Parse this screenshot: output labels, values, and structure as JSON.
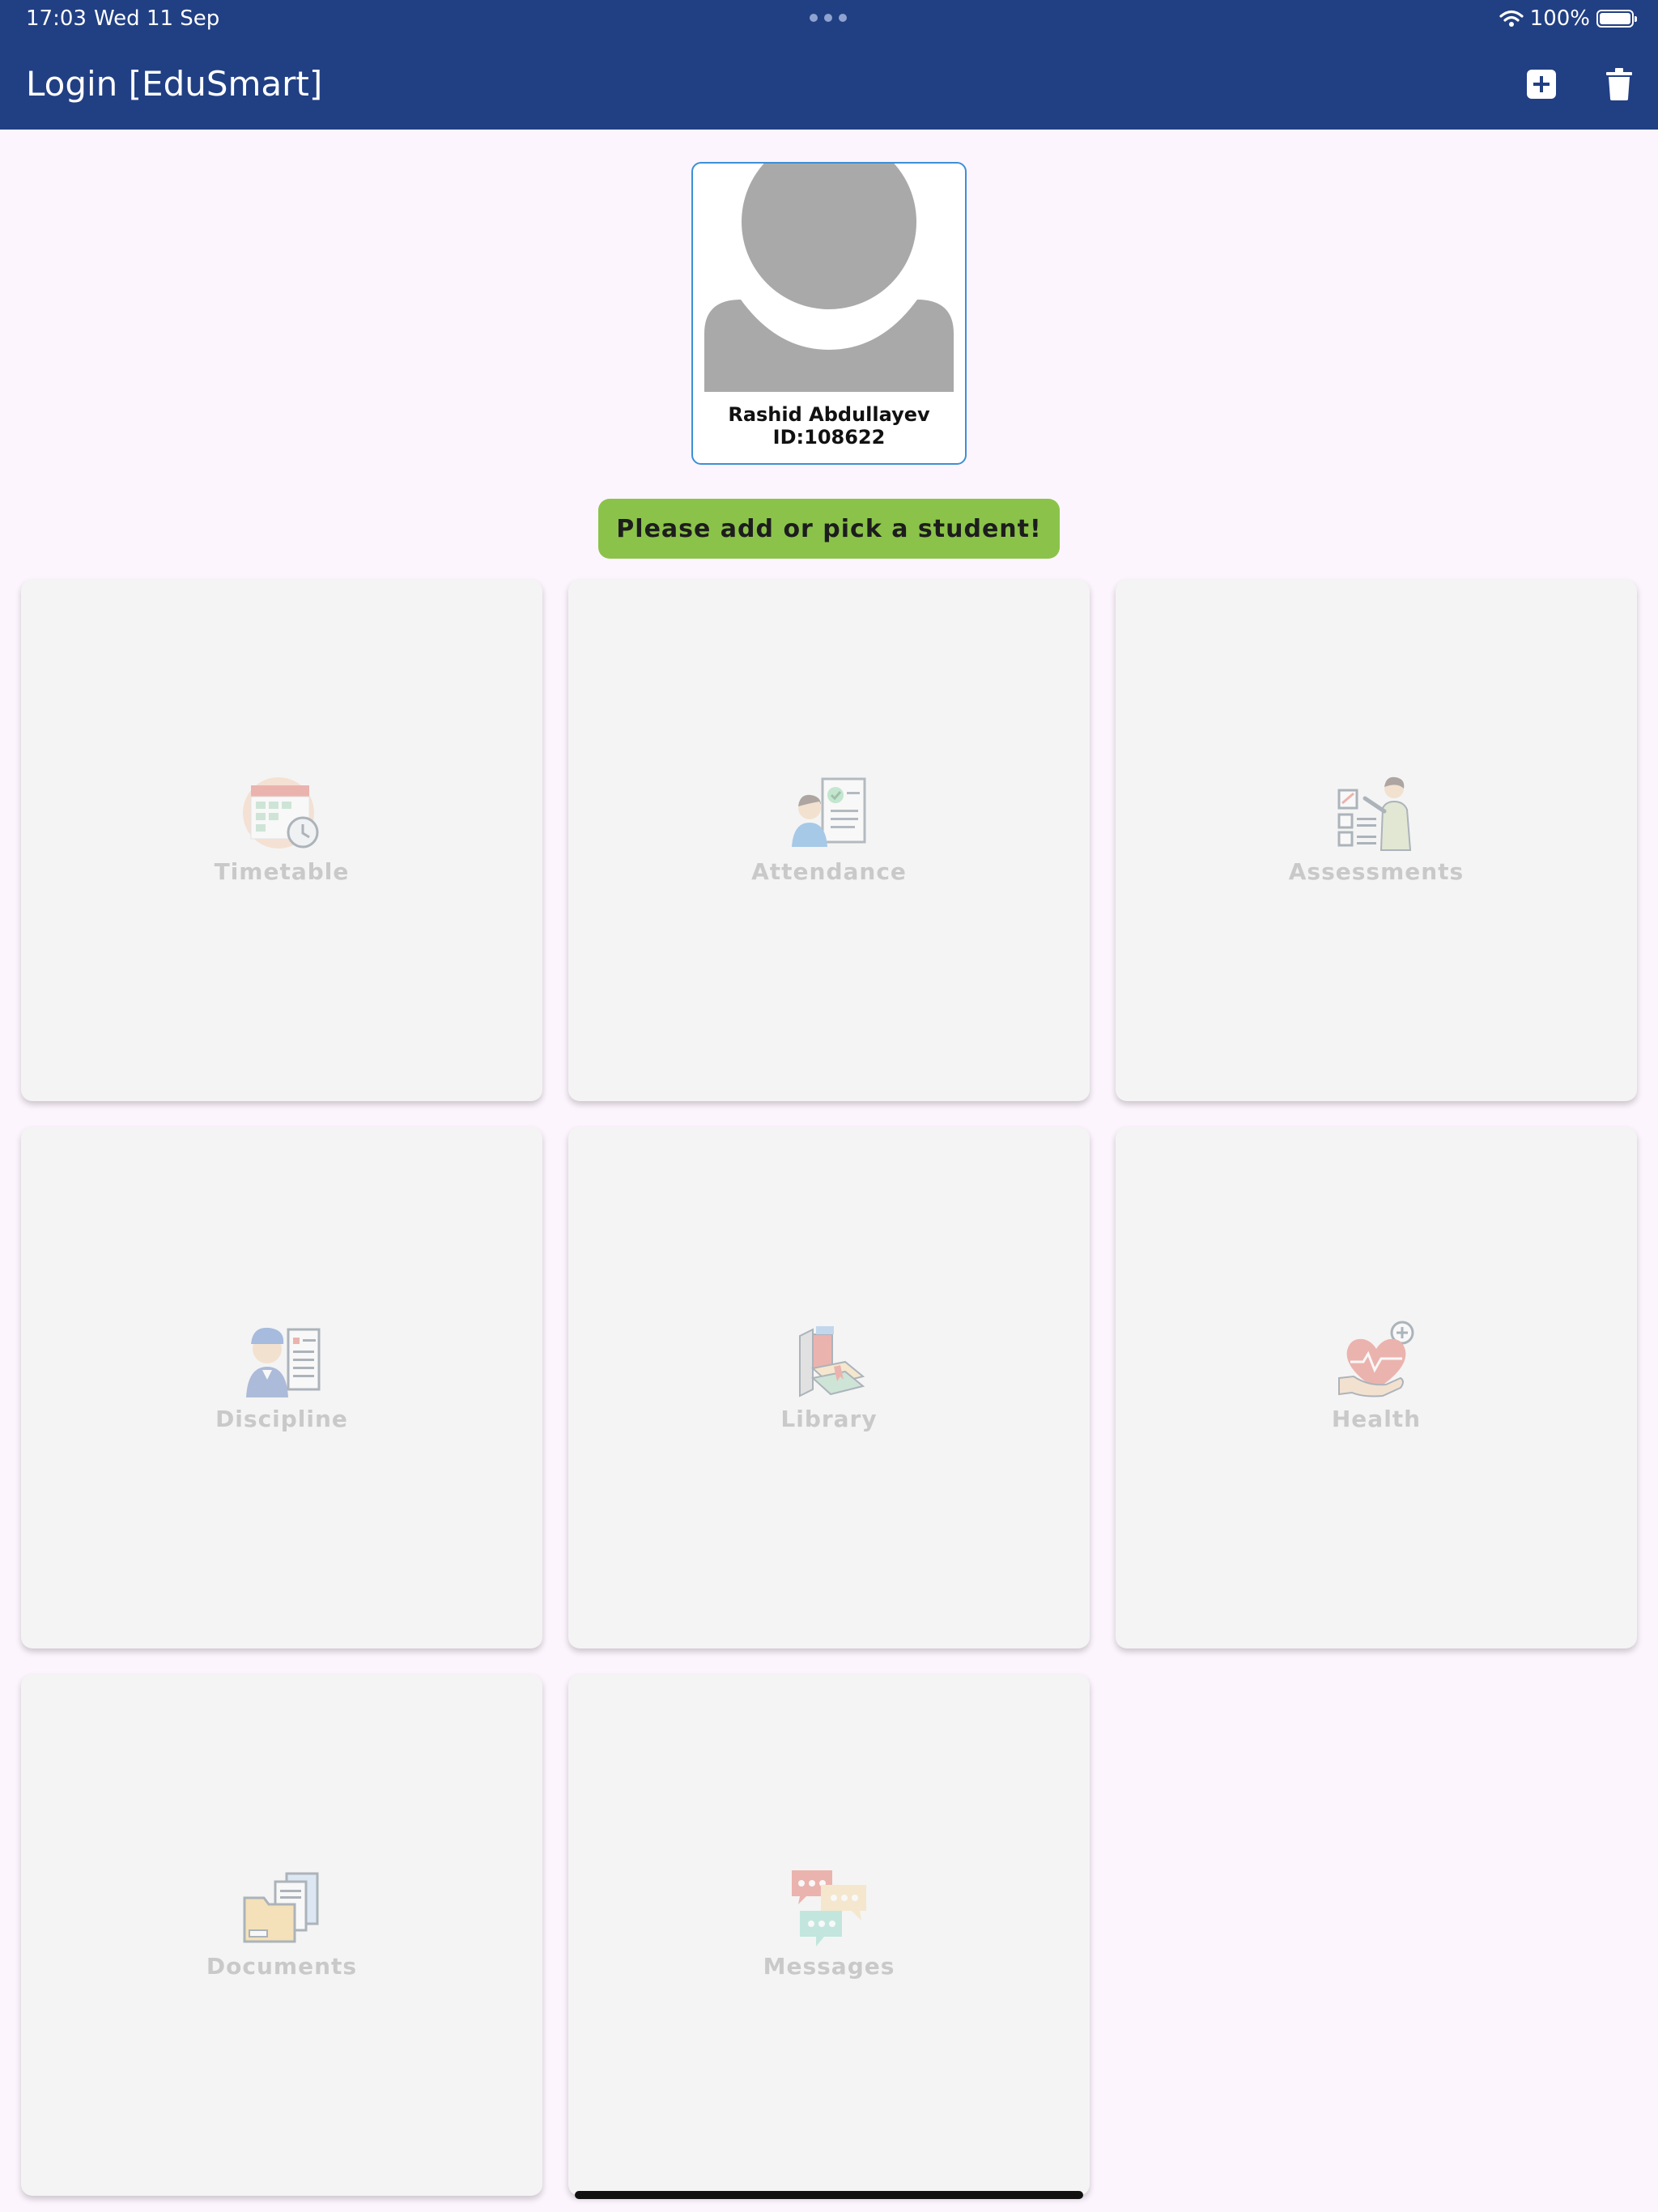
{
  "status_bar": {
    "time": "17:03",
    "date": "Wed 11 Sep",
    "battery": "100%"
  },
  "app_bar": {
    "title": "Login [EduSmart]",
    "add_icon": "plus-square-icon",
    "delete_icon": "trash-icon"
  },
  "student": {
    "name": "Rashid Abdullayev",
    "id": "ID:108622"
  },
  "notice": "Please add or pick a student!",
  "tiles": [
    {
      "label": "Timetable",
      "icon": "timetable-icon"
    },
    {
      "label": "Attendance",
      "icon": "attendance-icon"
    },
    {
      "label": "Assessments",
      "icon": "assessments-icon"
    },
    {
      "label": "Discipline",
      "icon": "discipline-icon"
    },
    {
      "label": "Library",
      "icon": "library-icon"
    },
    {
      "label": "Health",
      "icon": "health-icon"
    },
    {
      "label": "Documents",
      "icon": "documents-icon"
    },
    {
      "label": "Messages",
      "icon": "messages-icon"
    }
  ],
  "colors": {
    "app_bar": "#213f83",
    "background": "#fdf5fd",
    "notice": "#8bc34a",
    "card_border": "#3d8fd6",
    "tile": "#f4f4f4"
  }
}
